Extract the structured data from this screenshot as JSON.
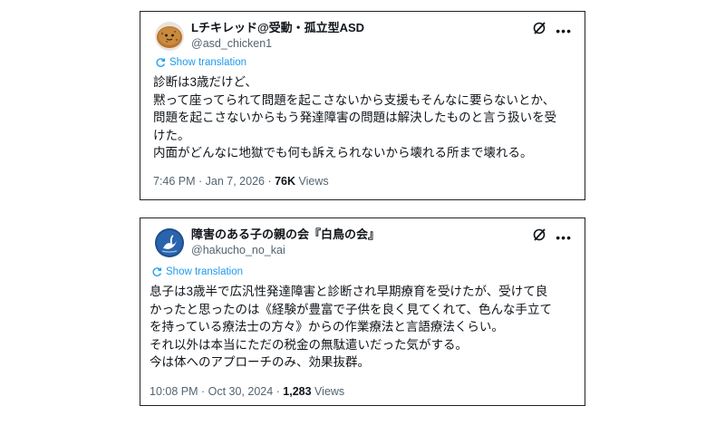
{
  "tweets": [
    {
      "display_name": "Lチキレッド@受動・孤立型ASD",
      "handle": "@asd_chicken1",
      "translate_label": "Show translation",
      "lines": [
        "診断は3歳だけど、",
        "黙って座ってられて問題を起こさないから支援もそんなに要らないとか、",
        "問題を起こさないからもう発達障害の問題は解決したものと言う扱いを受",
        "けた。",
        "内面がどんなに地獄でも何も訴えられないから壊れる所まで壊れる。"
      ],
      "timestamp": "7:46 PM · Jan 7, 2026 · ",
      "views_count": "76K",
      "views_label": " Views",
      "avatar": "brown-chicken-nugget-avatar"
    },
    {
      "display_name": "障害のある子の親の会『白鳥の会』",
      "handle": "@hakucho_no_kai",
      "translate_label": "Show translation",
      "lines": [
        "息子は3歳半で広汎性発達障害と診断され早期療育を受けたが、受けて良",
        "かったと思ったのは《経験が豊富で子供を良く見てくれて、色んな手立て",
        "を持っている療法士の方々》からの作業療法と言語療法くらい。",
        "それ以外は本当にただの税金の無駄遣いだった気がする。",
        "今は体へのアプローチのみ、効果抜群。"
      ],
      "timestamp": "10:08 PM · Oct 30, 2024 · ",
      "views_count": "1,283",
      "views_label": " Views",
      "avatar": "swan-logo-avatar"
    }
  ],
  "colors": {
    "link": "#1d9bf0",
    "muted": "#536471",
    "text": "#0f1419"
  }
}
